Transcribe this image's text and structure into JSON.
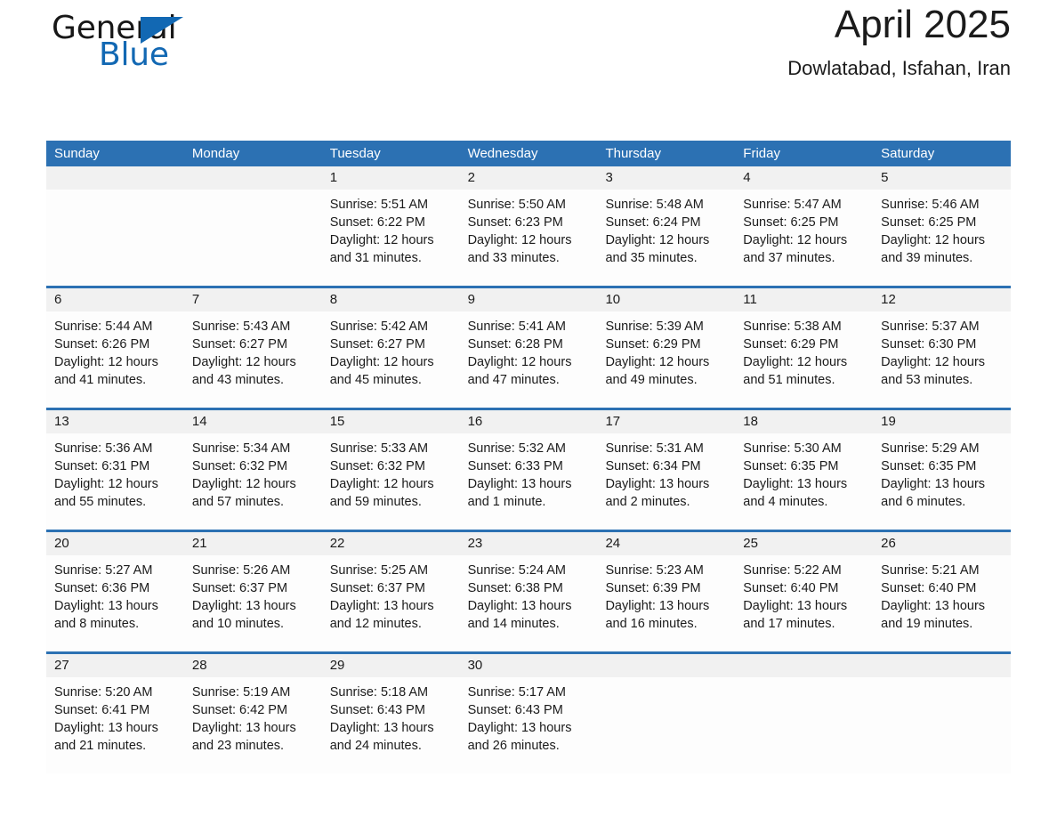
{
  "logo": {
    "word_one": "General",
    "word_two": "Blue",
    "accent_color": "#1268b3",
    "triangle_icon": "triangle-icon"
  },
  "header": {
    "month_title": "April 2025",
    "location": "Dowlatabad, Isfahan, Iran"
  },
  "calendar": {
    "header_bg": "#2c71b3",
    "row_divider_color": "#2c71b3",
    "daynum_band_bg": "#f1f1f1",
    "weekdays": [
      "Sunday",
      "Monday",
      "Tuesday",
      "Wednesday",
      "Thursday",
      "Friday",
      "Saturday"
    ],
    "weeks": [
      [
        {
          "day": ""
        },
        {
          "day": ""
        },
        {
          "day": "1",
          "sunrise": "Sunrise: 5:51 AM",
          "sunset": "Sunset: 6:22 PM",
          "daylight_1": "Daylight: 12 hours",
          "daylight_2": "and 31 minutes."
        },
        {
          "day": "2",
          "sunrise": "Sunrise: 5:50 AM",
          "sunset": "Sunset: 6:23 PM",
          "daylight_1": "Daylight: 12 hours",
          "daylight_2": "and 33 minutes."
        },
        {
          "day": "3",
          "sunrise": "Sunrise: 5:48 AM",
          "sunset": "Sunset: 6:24 PM",
          "daylight_1": "Daylight: 12 hours",
          "daylight_2": "and 35 minutes."
        },
        {
          "day": "4",
          "sunrise": "Sunrise: 5:47 AM",
          "sunset": "Sunset: 6:25 PM",
          "daylight_1": "Daylight: 12 hours",
          "daylight_2": "and 37 minutes."
        },
        {
          "day": "5",
          "sunrise": "Sunrise: 5:46 AM",
          "sunset": "Sunset: 6:25 PM",
          "daylight_1": "Daylight: 12 hours",
          "daylight_2": "and 39 minutes."
        }
      ],
      [
        {
          "day": "6",
          "sunrise": "Sunrise: 5:44 AM",
          "sunset": "Sunset: 6:26 PM",
          "daylight_1": "Daylight: 12 hours",
          "daylight_2": "and 41 minutes."
        },
        {
          "day": "7",
          "sunrise": "Sunrise: 5:43 AM",
          "sunset": "Sunset: 6:27 PM",
          "daylight_1": "Daylight: 12 hours",
          "daylight_2": "and 43 minutes."
        },
        {
          "day": "8",
          "sunrise": "Sunrise: 5:42 AM",
          "sunset": "Sunset: 6:27 PM",
          "daylight_1": "Daylight: 12 hours",
          "daylight_2": "and 45 minutes."
        },
        {
          "day": "9",
          "sunrise": "Sunrise: 5:41 AM",
          "sunset": "Sunset: 6:28 PM",
          "daylight_1": "Daylight: 12 hours",
          "daylight_2": "and 47 minutes."
        },
        {
          "day": "10",
          "sunrise": "Sunrise: 5:39 AM",
          "sunset": "Sunset: 6:29 PM",
          "daylight_1": "Daylight: 12 hours",
          "daylight_2": "and 49 minutes."
        },
        {
          "day": "11",
          "sunrise": "Sunrise: 5:38 AM",
          "sunset": "Sunset: 6:29 PM",
          "daylight_1": "Daylight: 12 hours",
          "daylight_2": "and 51 minutes."
        },
        {
          "day": "12",
          "sunrise": "Sunrise: 5:37 AM",
          "sunset": "Sunset: 6:30 PM",
          "daylight_1": "Daylight: 12 hours",
          "daylight_2": "and 53 minutes."
        }
      ],
      [
        {
          "day": "13",
          "sunrise": "Sunrise: 5:36 AM",
          "sunset": "Sunset: 6:31 PM",
          "daylight_1": "Daylight: 12 hours",
          "daylight_2": "and 55 minutes."
        },
        {
          "day": "14",
          "sunrise": "Sunrise: 5:34 AM",
          "sunset": "Sunset: 6:32 PM",
          "daylight_1": "Daylight: 12 hours",
          "daylight_2": "and 57 minutes."
        },
        {
          "day": "15",
          "sunrise": "Sunrise: 5:33 AM",
          "sunset": "Sunset: 6:32 PM",
          "daylight_1": "Daylight: 12 hours",
          "daylight_2": "and 59 minutes."
        },
        {
          "day": "16",
          "sunrise": "Sunrise: 5:32 AM",
          "sunset": "Sunset: 6:33 PM",
          "daylight_1": "Daylight: 13 hours",
          "daylight_2": "and 1 minute."
        },
        {
          "day": "17",
          "sunrise": "Sunrise: 5:31 AM",
          "sunset": "Sunset: 6:34 PM",
          "daylight_1": "Daylight: 13 hours",
          "daylight_2": "and 2 minutes."
        },
        {
          "day": "18",
          "sunrise": "Sunrise: 5:30 AM",
          "sunset": "Sunset: 6:35 PM",
          "daylight_1": "Daylight: 13 hours",
          "daylight_2": "and 4 minutes."
        },
        {
          "day": "19",
          "sunrise": "Sunrise: 5:29 AM",
          "sunset": "Sunset: 6:35 PM",
          "daylight_1": "Daylight: 13 hours",
          "daylight_2": "and 6 minutes."
        }
      ],
      [
        {
          "day": "20",
          "sunrise": "Sunrise: 5:27 AM",
          "sunset": "Sunset: 6:36 PM",
          "daylight_1": "Daylight: 13 hours",
          "daylight_2": "and 8 minutes."
        },
        {
          "day": "21",
          "sunrise": "Sunrise: 5:26 AM",
          "sunset": "Sunset: 6:37 PM",
          "daylight_1": "Daylight: 13 hours",
          "daylight_2": "and 10 minutes."
        },
        {
          "day": "22",
          "sunrise": "Sunrise: 5:25 AM",
          "sunset": "Sunset: 6:37 PM",
          "daylight_1": "Daylight: 13 hours",
          "daylight_2": "and 12 minutes."
        },
        {
          "day": "23",
          "sunrise": "Sunrise: 5:24 AM",
          "sunset": "Sunset: 6:38 PM",
          "daylight_1": "Daylight: 13 hours",
          "daylight_2": "and 14 minutes."
        },
        {
          "day": "24",
          "sunrise": "Sunrise: 5:23 AM",
          "sunset": "Sunset: 6:39 PM",
          "daylight_1": "Daylight: 13 hours",
          "daylight_2": "and 16 minutes."
        },
        {
          "day": "25",
          "sunrise": "Sunrise: 5:22 AM",
          "sunset": "Sunset: 6:40 PM",
          "daylight_1": "Daylight: 13 hours",
          "daylight_2": "and 17 minutes."
        },
        {
          "day": "26",
          "sunrise": "Sunrise: 5:21 AM",
          "sunset": "Sunset: 6:40 PM",
          "daylight_1": "Daylight: 13 hours",
          "daylight_2": "and 19 minutes."
        }
      ],
      [
        {
          "day": "27",
          "sunrise": "Sunrise: 5:20 AM",
          "sunset": "Sunset: 6:41 PM",
          "daylight_1": "Daylight: 13 hours",
          "daylight_2": "and 21 minutes."
        },
        {
          "day": "28",
          "sunrise": "Sunrise: 5:19 AM",
          "sunset": "Sunset: 6:42 PM",
          "daylight_1": "Daylight: 13 hours",
          "daylight_2": "and 23 minutes."
        },
        {
          "day": "29",
          "sunrise": "Sunrise: 5:18 AM",
          "sunset": "Sunset: 6:43 PM",
          "daylight_1": "Daylight: 13 hours",
          "daylight_2": "and 24 minutes."
        },
        {
          "day": "30",
          "sunrise": "Sunrise: 5:17 AM",
          "sunset": "Sunset: 6:43 PM",
          "daylight_1": "Daylight: 13 hours",
          "daylight_2": "and 26 minutes."
        },
        {
          "day": ""
        },
        {
          "day": ""
        },
        {
          "day": ""
        }
      ]
    ]
  }
}
